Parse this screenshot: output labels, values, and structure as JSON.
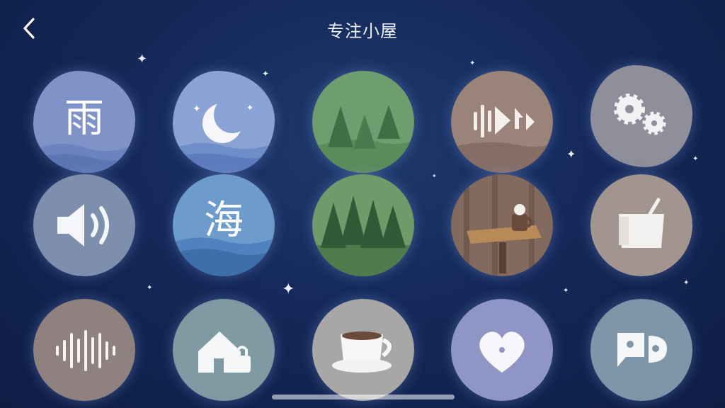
{
  "header": {
    "title": "专注小屋",
    "back_icon": "chevron-left-icon"
  },
  "tiles": [
    {
      "id": "rain",
      "icon": "rain-character-icon",
      "glyph": "雨",
      "bg": "#7f93c8"
    },
    {
      "id": "night",
      "icon": "moon-icon",
      "bg": "#8aa3d4"
    },
    {
      "id": "forest-hill",
      "icon": "pine-trees-icon",
      "bg": "#6e9d6f"
    },
    {
      "id": "sound-wave-arrows",
      "icon": "sound-wave-icon",
      "bg": "#9a8378"
    },
    {
      "id": "gears",
      "icon": "gears-icon",
      "bg": "#8e8f9a"
    },
    {
      "id": "volume",
      "icon": "speaker-icon",
      "bg": "#7e8fae"
    },
    {
      "id": "sea",
      "icon": "sea-character-icon",
      "glyph": "海",
      "bg": "#6d9ccc"
    },
    {
      "id": "forest",
      "icon": "forest-icon",
      "bg": "#6f9a6a"
    },
    {
      "id": "cafe",
      "icon": "coffee-table-icon",
      "bg": "#826a5e"
    },
    {
      "id": "tag",
      "icon": "tag-icon",
      "bg": "#a29590"
    },
    {
      "id": "waveform",
      "icon": "waveform-icon",
      "bg": "#8e817f"
    },
    {
      "id": "home-lock",
      "icon": "home-lock-icon",
      "bg": "#7f9aa2"
    },
    {
      "id": "coffee",
      "icon": "coffee-cup-icon",
      "bg": "#a9a6a6"
    },
    {
      "id": "heart",
      "icon": "heart-icon",
      "bg": "#8f95c4"
    },
    {
      "id": "chat",
      "icon": "chat-bubbles-icon",
      "bg": "#7f95a8"
    }
  ],
  "colors": {
    "bg_top": "#1f3a6e",
    "bg_bottom": "#0e1d44",
    "text": "#eef2fa"
  }
}
